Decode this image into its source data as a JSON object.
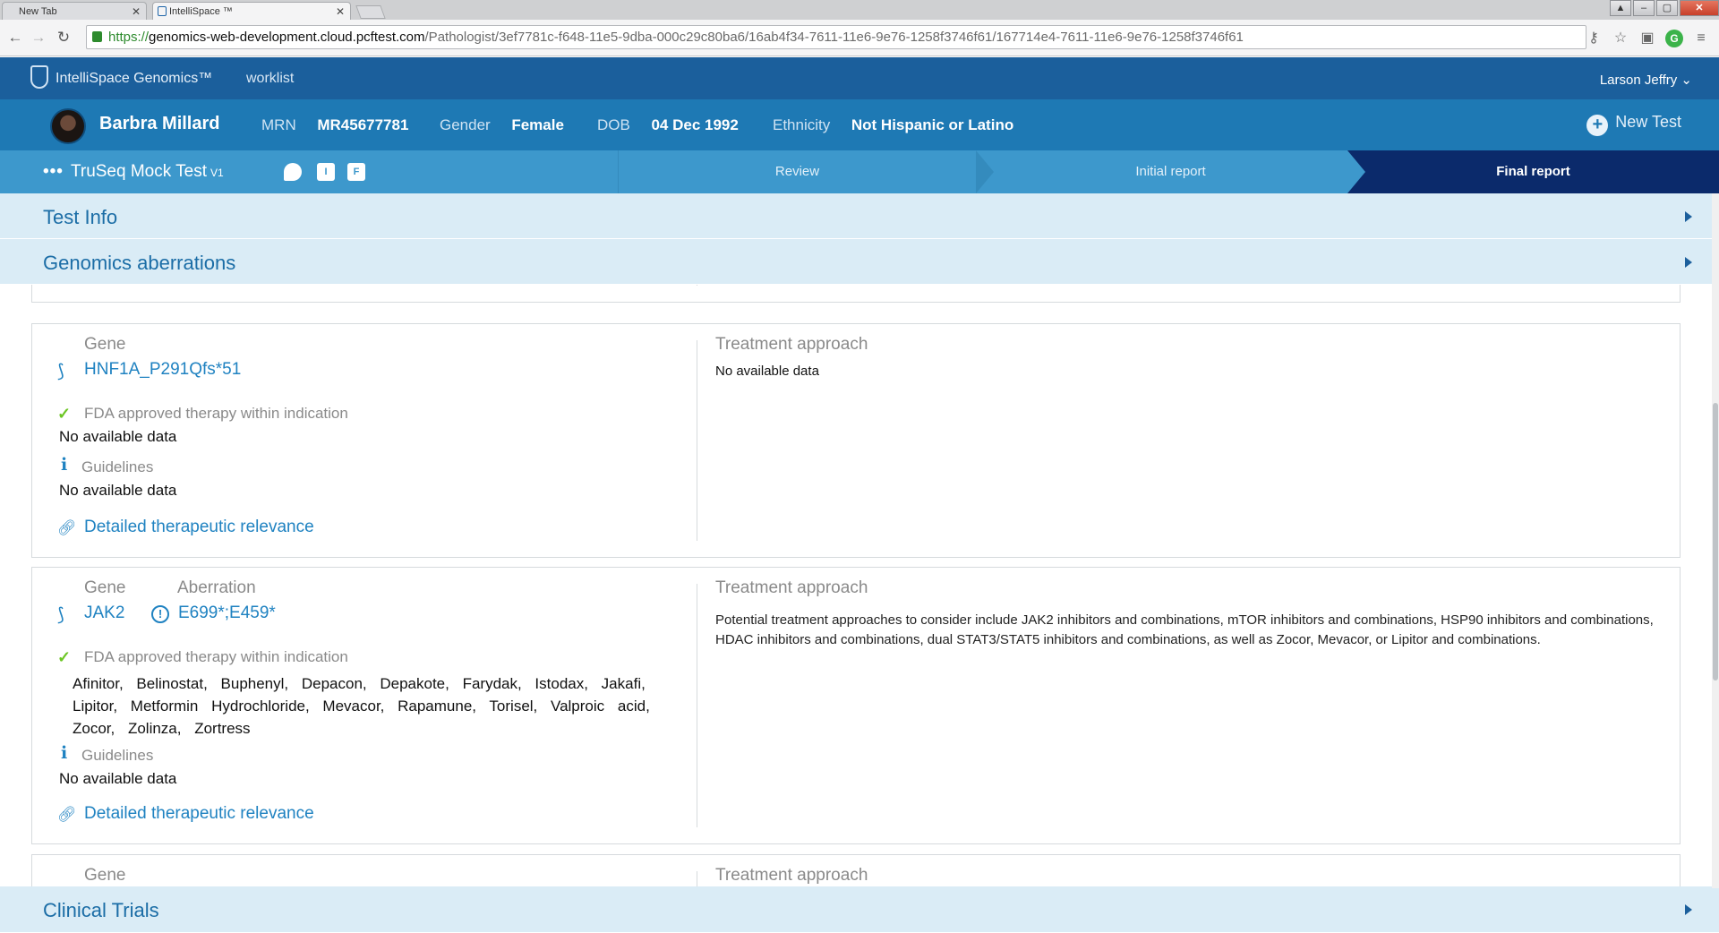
{
  "browser": {
    "tabs": [
      {
        "title": "New Tab"
      },
      {
        "title": "IntelliSpace ™"
      }
    ],
    "url": {
      "scheme": "https://",
      "host": "genomics-web-development.cloud.pcftest.com",
      "path": "/Pathologist/3ef7781c-f648-11e5-9dba-000c29c80ba6/16ab4f34-7611-11e6-9e76-1258f3746f61/167714e4-7611-11e6-9e76-1258f3746f61"
    }
  },
  "app": {
    "brand": "IntelliSpace Genomics™",
    "nav_worklist": "worklist",
    "user": "Larson Jeffry ⌄"
  },
  "patient": {
    "name": "Barbra Millard",
    "mrn_label": "MRN",
    "mrn": "MR45677781",
    "gender_label": "Gender",
    "gender": "Female",
    "dob_label": "DOB",
    "dob": "04 Dec 1992",
    "ethnicity_label": "Ethnicity",
    "ethnicity": "Not Hispanic or Latino",
    "new_test": "New Test"
  },
  "test": {
    "name": "TruSeq Mock Test",
    "version": "V1",
    "icons": {
      "i": "I",
      "f": "F"
    },
    "steps": [
      "Review",
      "Initial report",
      "Final report"
    ]
  },
  "sections": {
    "test_info": "Test Info",
    "genomic_aberrations": "Genomics aberrations",
    "clinical_trials": "Clinical Trials"
  },
  "labels": {
    "gene": "Gene",
    "aberration": "Aberration",
    "fda": "FDA approved therapy within indication",
    "guidelines": "Guidelines",
    "treatment": "Treatment approach",
    "detailed": "Detailed therapeutic relevance",
    "no_data": "No available data"
  },
  "cards": [
    {
      "gene": "HNF1A_P291Qfs*51",
      "fda": "No available data",
      "guidelines": "No available data",
      "treatment": "No available data"
    },
    {
      "gene": "JAK2",
      "aberration": "E699*;E459*",
      "fda_therapies": "Afinitor, Belinostat, Buphenyl, Depacon, Depakote, Farydak, Istodax, Jakafi, Lipitor, Metformin Hydrochloride, Mevacor, Rapamune, Torisel, Valproic acid, Zocor, Zolinza, Zortress",
      "guidelines": "No available data",
      "treatment": "Potential treatment approaches to consider include JAK2 inhibitors and combinations, mTOR inhibitors and combinations, HSP90 inhibitors and combinations, HDAC inhibitors and combinations, dual STAT3/STAT5 inhibitors and combinations, as well as Zocor, Mevacor, or Lipitor and combinations."
    }
  ],
  "icons": [
    "back-icon",
    "forward-icon",
    "reload-icon",
    "lock-icon",
    "key-icon",
    "star-icon",
    "extension-icon",
    "grammarly-icon",
    "menu-icon",
    "philips-shield-icon",
    "plus-icon",
    "chat-icon",
    "gene-icon",
    "check-icon",
    "info-icon",
    "link-icon",
    "alert-icon",
    "chevron-right-icon"
  ]
}
